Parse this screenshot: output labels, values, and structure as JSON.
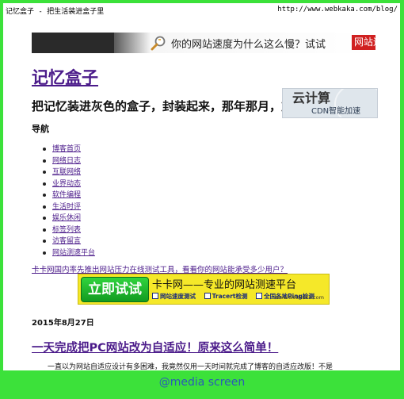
{
  "print_header": {
    "title": "记忆盒子 - 把生活装进盒子里",
    "url": "http://www.webkaka.com/blog/"
  },
  "banner": {
    "text": "你的网站速度为什么这么慢？试试",
    "button_text": "网站速",
    "icon": "magnifier-icon"
  },
  "site": {
    "title": "记忆盒子",
    "description": "把记忆装进灰色的盒子，封装起来，那年那月，重新拾起"
  },
  "cloud_ad": {
    "title": "云计算",
    "subtitle": "CDN智能加速"
  },
  "nav": {
    "heading": "导航",
    "items": [
      {
        "label": "博客首页"
      },
      {
        "label": "网络日志"
      },
      {
        "label": "互联网络"
      },
      {
        "label": "业界动态"
      },
      {
        "label": "软件编程"
      },
      {
        "label": "生活时评"
      },
      {
        "label": "娱乐休闲"
      },
      {
        "label": "标签列表"
      },
      {
        "label": "访客留言"
      },
      {
        "label": "网站测速平台"
      }
    ]
  },
  "promo_link": "卡卡网国内率先推出网站压力在线测试工具，看看你的网站能承受多少用户？",
  "speed_ad": {
    "button": "立即试试",
    "slogan": "卡卡网——专业的网站测速平台",
    "domain": "www.webkaka.com",
    "tools": [
      "网站速度测试",
      "Tracert检测",
      "全国各地Ping检测"
    ]
  },
  "post": {
    "date": "2015年8月27日",
    "title": "一天完成把PC网站改为自适应！原来这么简单！",
    "excerpt": "一直以为网站自适应设计有多困难，我竟然仅用一天时间就完成了博客的自适应改版！不是"
  },
  "footer_label": "@media screen",
  "colors": {
    "background": "#3ce13a",
    "link": "#4b1b8a",
    "ad_yellow": "#f5e829",
    "ad_green": "#1fae2e",
    "banner_red": "#d02020",
    "caption": "#2a5ab8"
  }
}
